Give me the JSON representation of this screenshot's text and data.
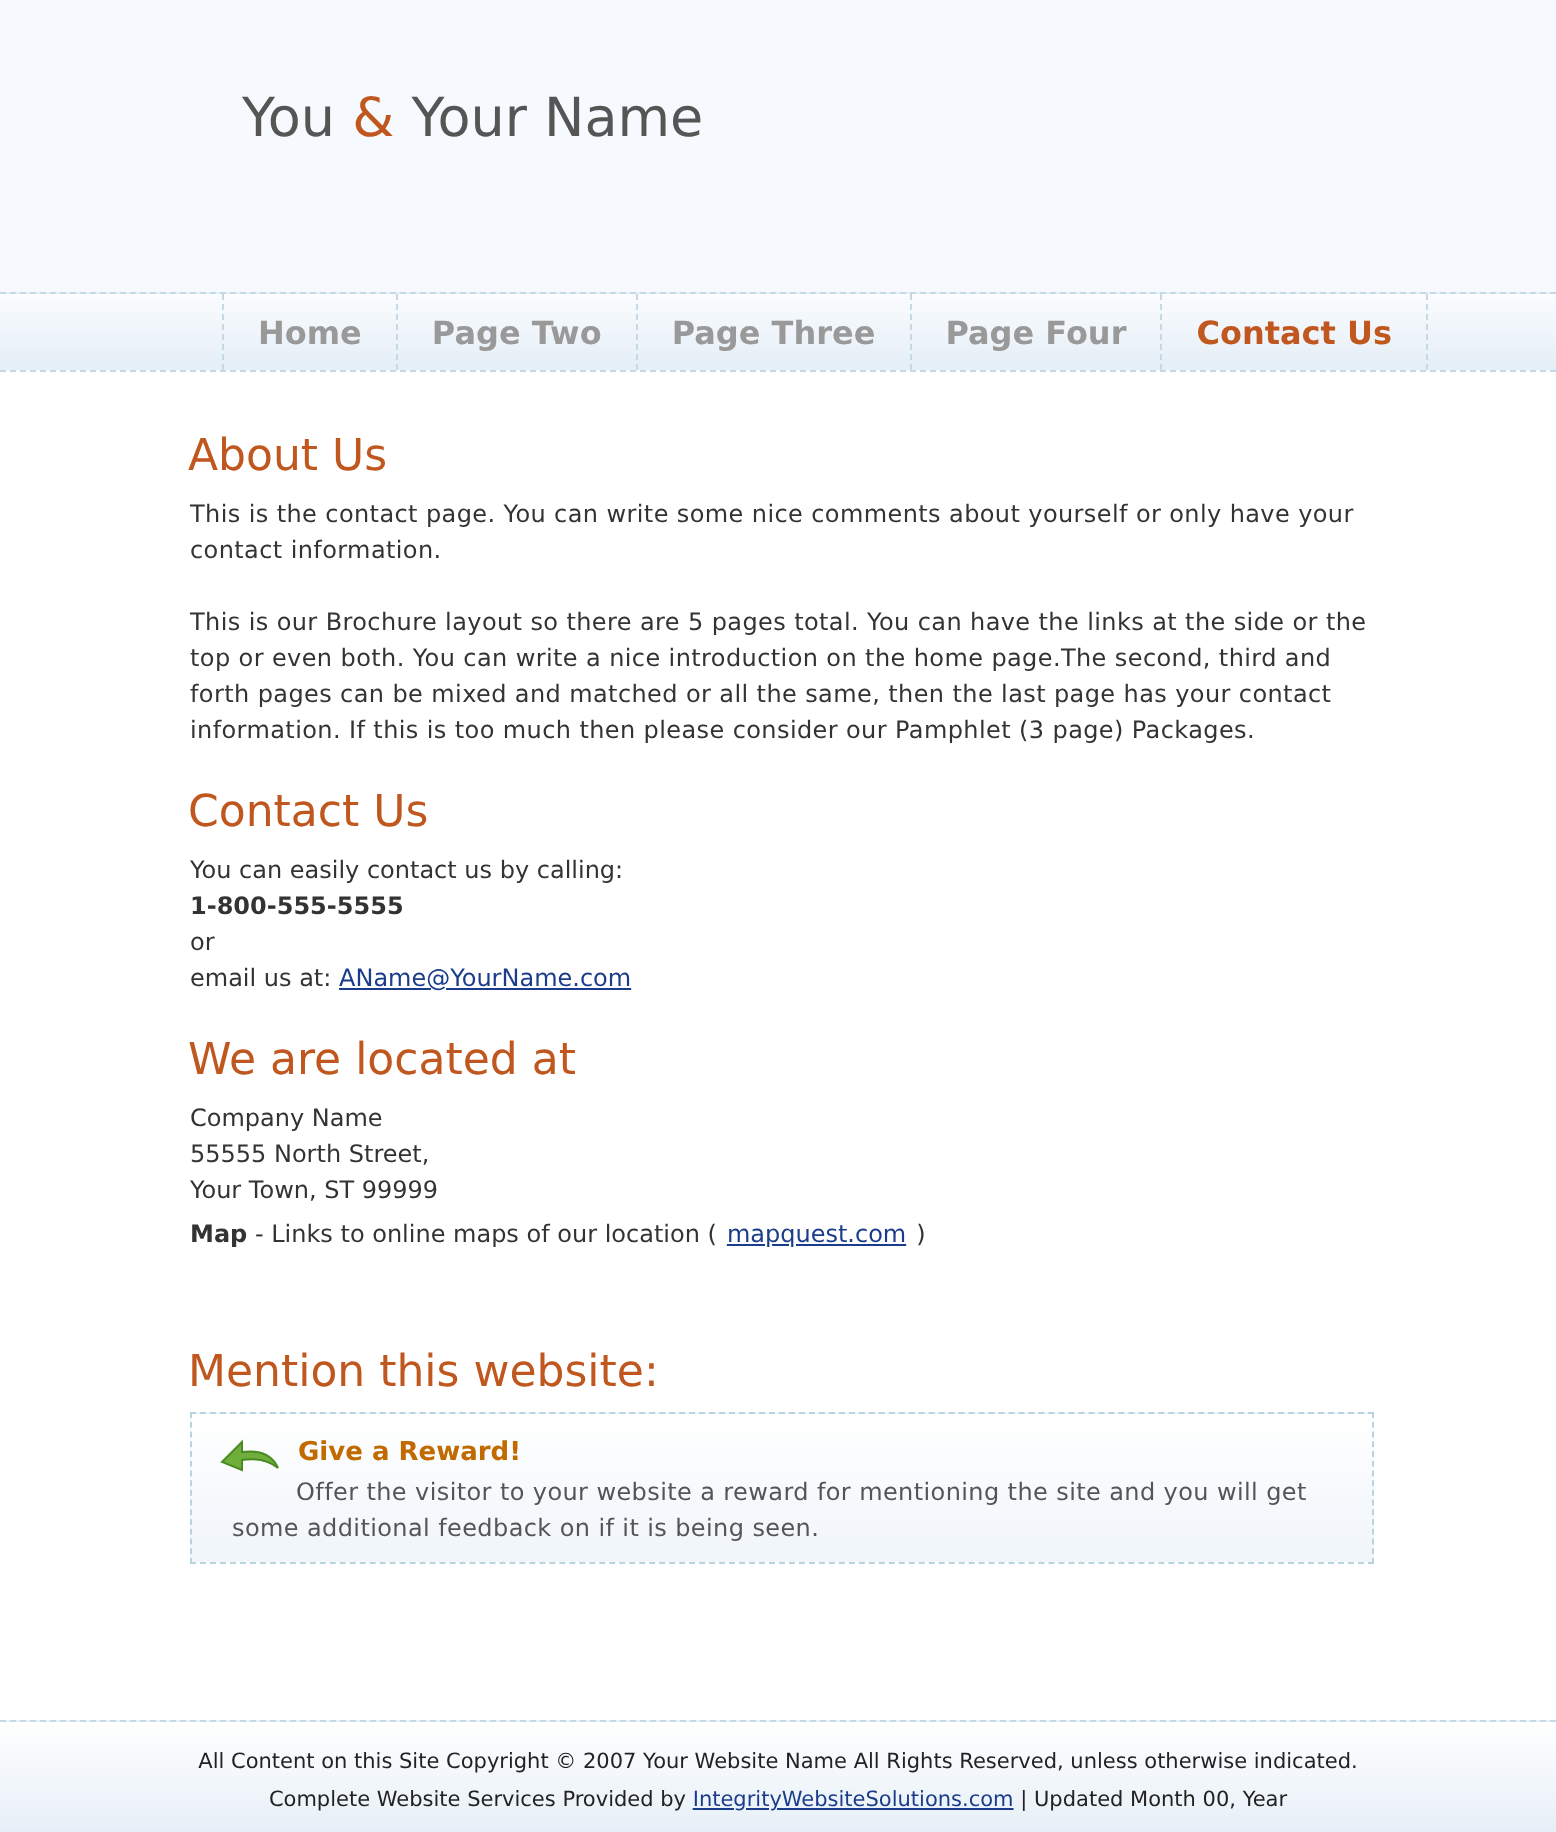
{
  "logo": {
    "before": "You",
    "amp": "&",
    "after": "Your Name"
  },
  "nav": [
    {
      "label": "Home",
      "selected": false
    },
    {
      "label": "Page Two",
      "selected": false
    },
    {
      "label": "Page Three",
      "selected": false
    },
    {
      "label": "Page Four",
      "selected": false
    },
    {
      "label": "Contact Us",
      "selected": true
    }
  ],
  "about": {
    "title": "About Us",
    "paragraphs": [
      "This is the contact page. You can write some nice comments about yourself or only have your contact information.",
      "This is our Brochure layout so there are 5 pages total. You can have the links at the side or the top or even both. You can write a nice introduction on the home page.The second, third and forth pages can be mixed and matched or all the same, then the last page has your contact information. If this is too much then please consider our Pamphlet (3 page) Packages."
    ]
  },
  "contact": {
    "title": "Contact Us",
    "intro": "You can easily contact us by calling:",
    "phone": "1-800-555-5555",
    "or": "or",
    "email_label": "email us at:",
    "email": "AName@YourName.com"
  },
  "location": {
    "title": "We are located at",
    "address": [
      "Company Name",
      "55555 North Street,",
      "Your Town, ST 99999"
    ],
    "map_text": "**Map** - Links to online maps of our location (",
    "map_link": "mapquest.com",
    "map_end": ")"
  },
  "mention": {
    "title": "Mention this website:",
    "box_title": "Give a Reward!",
    "box_text": "Offer the visitor to your website a reward for mentioning the site and you will get some additional feedback on if it is being seen."
  },
  "footer": {
    "copyright": "All Content on this Site Copyright © 2007 Your Website Name All Rights Reserved, unless otherwise indicated.",
    "services": "Complete Website Services Provided by",
    "services_link": "IntegrityWebsiteSolutions.com",
    "updated": "| Updated Month 00, Year"
  }
}
